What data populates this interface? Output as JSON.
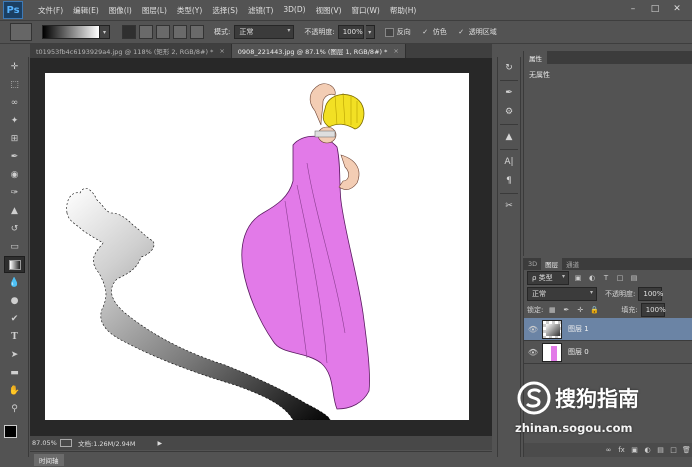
{
  "app": {
    "logo": "Ps"
  },
  "menu": [
    "文件(F)",
    "编辑(E)",
    "图像(I)",
    "图层(L)",
    "类型(Y)",
    "选择(S)",
    "滤镜(T)",
    "3D(D)",
    "视图(V)",
    "窗口(W)",
    "帮助(H)"
  ],
  "options": {
    "mode_label": "模式:",
    "mode_value": "正常",
    "opacity_label": "不透明度:",
    "opacity_value": "100%",
    "reverse_label": "反向",
    "dither_label": "仿色",
    "transparency_label": "透明区域",
    "reverse_checked": false,
    "dither_checked": true,
    "transparency_checked": true
  },
  "tabs": [
    {
      "label": "t01953fb4c6193929a4.jpg @ 118% (矩形 2, RGB/8#) *",
      "active": false
    },
    {
      "label": "0908_221443.jpg @ 87.1% (图层 1, RGB/8#) *",
      "active": true
    }
  ],
  "status": {
    "zoom": "87.05%",
    "doc": "文档:1.26M/2.94M"
  },
  "timeline_label": "时间轴",
  "properties": {
    "tab": "属性",
    "body": "无属性"
  },
  "layers_panel": {
    "tabs": [
      "3D",
      "图层",
      "通道"
    ],
    "active_tab": "图层",
    "filter": "ρ 类型",
    "blend": "正常",
    "opacity_label": "不透明度:",
    "opacity_value": "100%",
    "lock_label": "锁定:",
    "fill_label": "填充:",
    "fill_value": "100%",
    "layers": [
      {
        "name": "图层 1",
        "selected": true
      },
      {
        "name": "图层 0",
        "selected": false
      }
    ]
  },
  "watermark": {
    "brand": "搜狗指南",
    "url": "zhinan.sogou.com"
  },
  "colors": {
    "dress": "#e27ae8",
    "hair": "#f2e024",
    "selected_layer": "#6b84a5"
  }
}
